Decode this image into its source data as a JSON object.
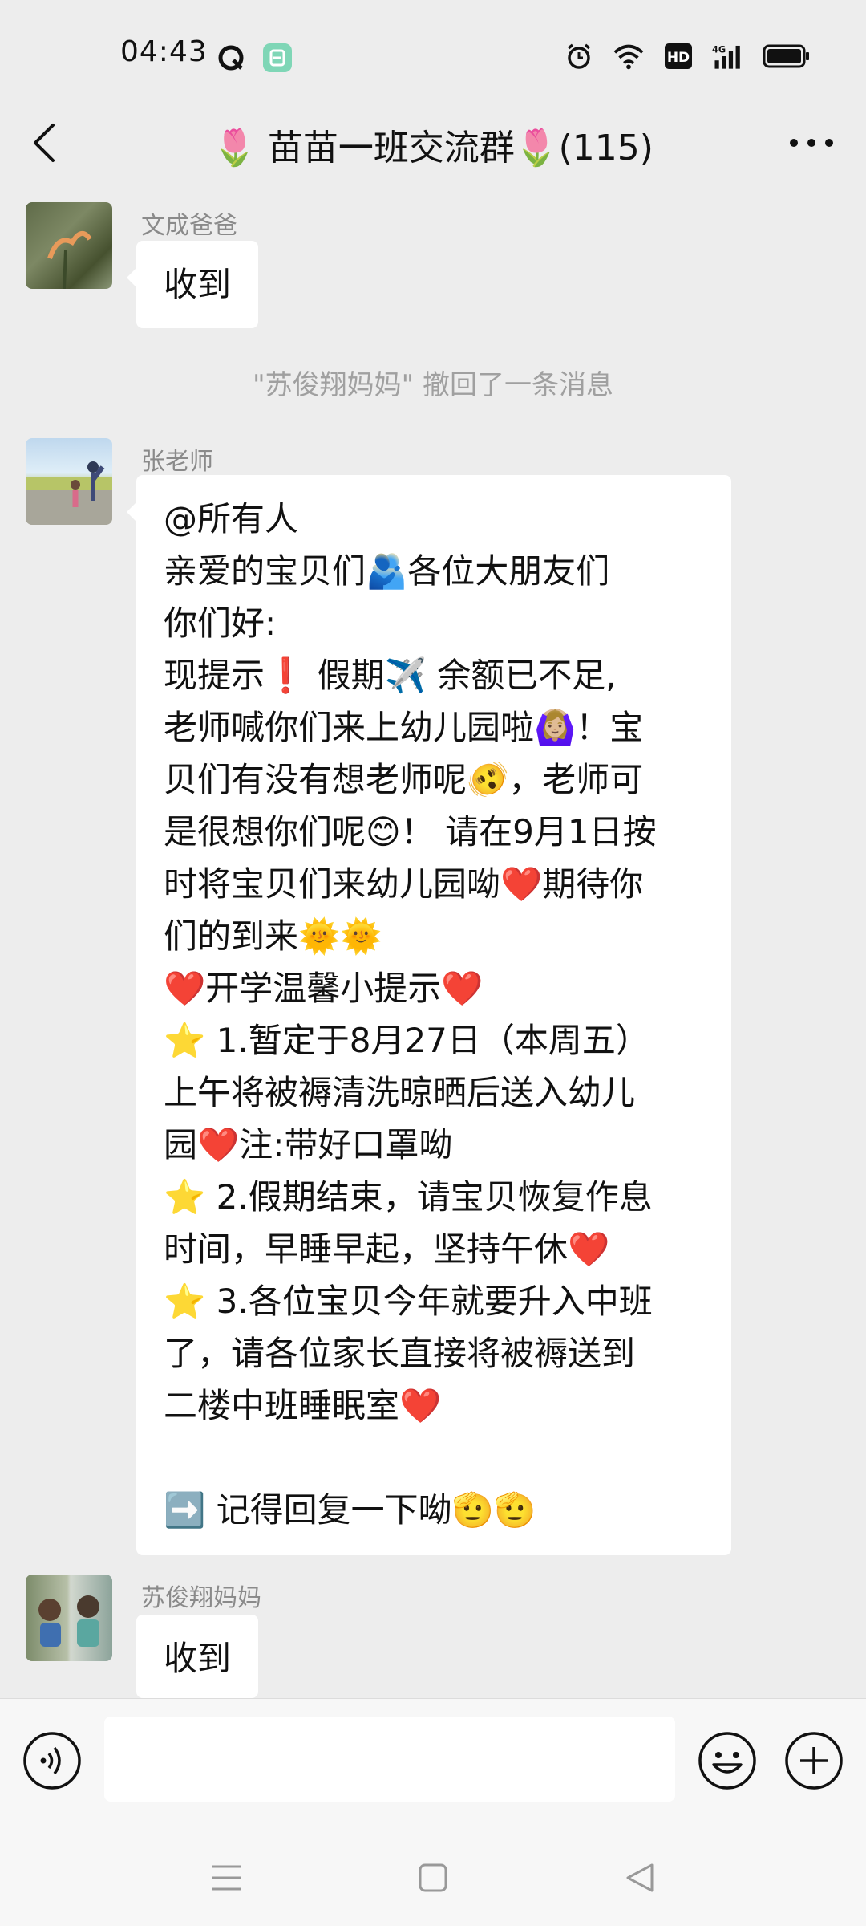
{
  "status_bar": {
    "time": "04:43",
    "icons": [
      "q-icon",
      "app-notification-icon",
      "alarm-icon",
      "wifi-icon",
      "hd-icon",
      "4g-signal-icon",
      "battery-icon"
    ]
  },
  "header": {
    "title": "🌷 苗苗一班交流群🌷(115)",
    "back_icon": "chevron-left-icon",
    "more_icon": "more-dots-icon"
  },
  "messages": [
    {
      "sender": "文成爸爸",
      "text": "收到"
    },
    {
      "sender": "张老师",
      "lines": [
        "@所有人",
        "亲爱的宝贝们🫂各位大朋友们",
        "你们好:",
        "现提示❗ 假期✈️ 余额已不足,",
        "老师喊你们来上幼儿园啦🙆🏼‍♀️！宝",
        "贝们有没有想老师呢🫨，老师可",
        "是很想你们呢😊！ 请在9月1日按",
        "时将宝贝们来幼儿园呦❤️期待你",
        "们的到来🌞🌞",
        "❤️开学温馨小提示❤️",
        "⭐ 1.暂定于8月27日（本周五）",
        "上午将被褥清洗晾晒后送入幼儿",
        "园❤️注:带好口罩呦",
        "⭐ 2.假期结束，请宝贝恢复作息",
        "时间，早睡早起，坚持午休❤️",
        "⭐ 3.各位宝贝今年就要升入中班",
        "了，请各位家长直接将被褥送到",
        "二楼中班睡眠室❤️",
        "",
        "➡️ 记得回复一下呦🫡🫡"
      ]
    },
    {
      "sender": "苏俊翔妈妈",
      "text": "收到"
    }
  ],
  "system_message": "\"苏俊翔妈妈\" 撤回了一条消息",
  "input_bar": {
    "placeholder": "",
    "voice_icon": "voice-icon",
    "emoji_icon": "emoji-icon",
    "plus_icon": "plus-icon"
  },
  "nav_bar": {
    "icons": [
      "menu-icon",
      "home-icon",
      "back-triangle-icon"
    ]
  }
}
